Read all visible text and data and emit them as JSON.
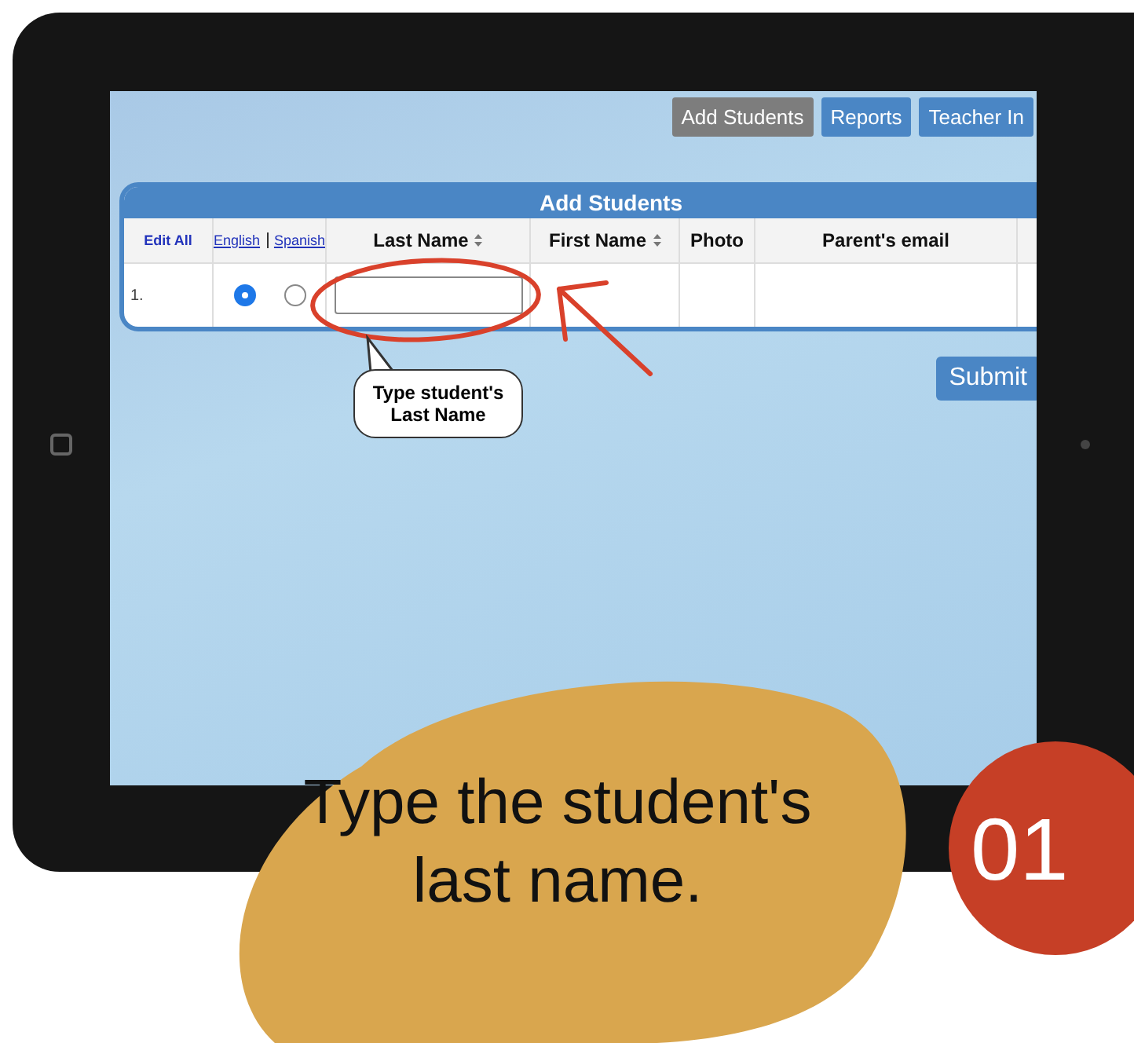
{
  "nav_tabs": [
    {
      "label": "Add Students",
      "selected": true
    },
    {
      "label": "Reports",
      "selected": false
    },
    {
      "label": "Teacher In",
      "selected": false
    }
  ],
  "table": {
    "title": "Add Students",
    "columns": [
      {
        "kind": "link",
        "label": "Edit All"
      },
      {
        "kind": "links",
        "labels": [
          "English",
          "Spanish"
        ]
      },
      {
        "kind": "header",
        "label": "Last Name",
        "sortable": true
      },
      {
        "kind": "header",
        "label": "First Name",
        "sortable": true
      },
      {
        "kind": "header",
        "label": "Photo",
        "sortable": false
      },
      {
        "kind": "header",
        "label": "Parent's email",
        "sortable": false
      },
      {
        "kind": "blank"
      }
    ],
    "rows": [
      {
        "number": "1.",
        "languages": [
          {
            "selected": true
          },
          {
            "selected": false
          }
        ]
      }
    ]
  },
  "submit": "Submit",
  "callout": [
    "Type student's",
    "Last Name"
  ],
  "caption": [
    "Type the student's",
    "last name."
  ],
  "step": "01"
}
